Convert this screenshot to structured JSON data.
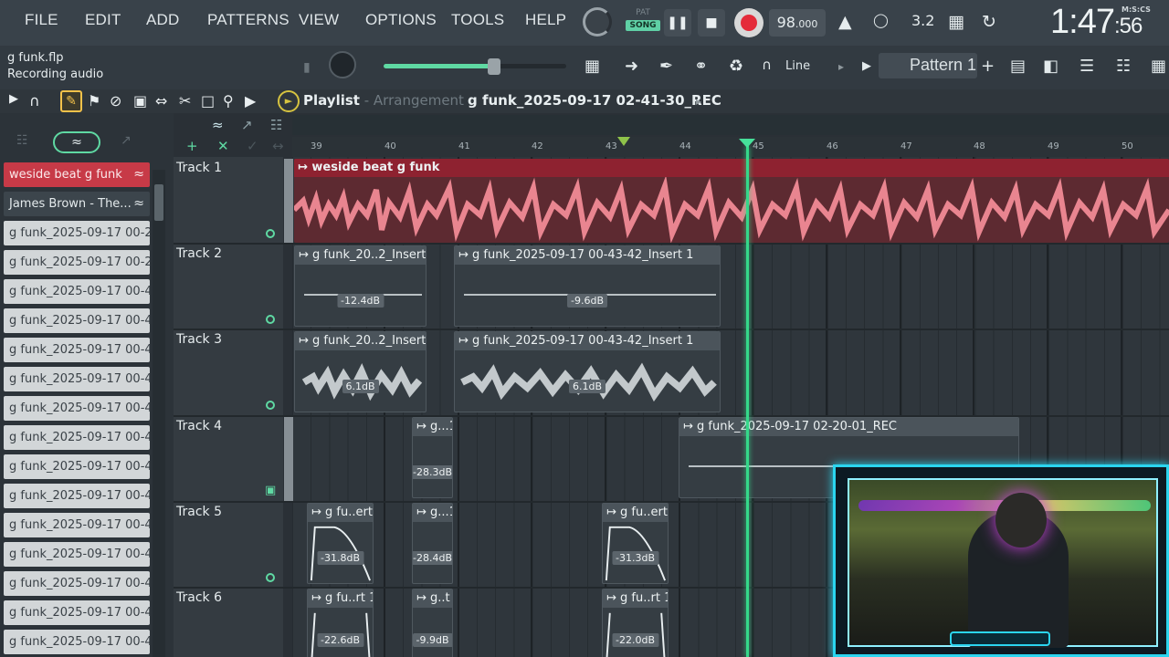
{
  "menu": [
    "FILE",
    "EDIT",
    "ADD",
    "PATTERNS",
    "VIEW",
    "OPTIONS",
    "TOOLS",
    "HELP"
  ],
  "transport": {
    "pat_label": "PAT",
    "song_label": "SONG",
    "tempo": "98",
    "tempo_decimal": ".000",
    "clock": "1:47",
    "clock_small": ":56",
    "clock_format": "M:S:CS",
    "cpu_readout": "3.2"
  },
  "project": {
    "filename": "g funk.flp",
    "status": "Recording audio"
  },
  "toolbar2": {
    "line_label": "Line",
    "pattern_label": "Pattern 1",
    "master_volume": 0.6
  },
  "playlist": {
    "title": "Playlist",
    "title_sep": " - ",
    "subtitle": "Arrangement",
    "recording_name": "g funk_2025-09-17 02-41-30_REC"
  },
  "browser_items": [
    "weside beat g funk",
    "James Brown - The...",
    "g funk_2025-09-17 00-2...",
    "g funk_2025-09-17 00-2...",
    "g funk_2025-09-17 00-4...",
    "g funk_2025-09-17 00-4...",
    "g funk_2025-09-17 00-4...",
    "g funk_2025-09-17 00-4...",
    "g funk_2025-09-17 00-4...",
    "g funk_2025-09-17 00-4...",
    "g funk_2025-09-17 00-4...",
    "g funk_2025-09-17 00-4...",
    "g funk_2025-09-17 00-4...",
    "g funk_2025-09-17 00-4...",
    "g funk_2025-09-17 00-4...",
    "g funk_2025-09-17 00-4...",
    "g funk_2025-09-17 00-4..."
  ],
  "ruler": {
    "bars": [
      "39",
      "40",
      "41",
      "42",
      "43",
      "44",
      "45",
      "46",
      "47",
      "48",
      "49",
      "50"
    ]
  },
  "tracks": [
    "Track 1",
    "Track 2",
    "Track 3",
    "Track 4",
    "Track 5",
    "Track 6"
  ],
  "clips": {
    "t1": {
      "name": "weside beat g funk"
    },
    "t2a": {
      "name": "g funk_20..2_Insert 1",
      "gain": "-12.4dB"
    },
    "t2b": {
      "name": "g funk_2025-09-17 00-43-42_Insert 1",
      "gain": "-9.6dB"
    },
    "t3a": {
      "name": "g funk_20..2_Insert 1",
      "gain": "6.1dB"
    },
    "t3b": {
      "name": "g funk_2025-09-17 00-43-42_Insert 1",
      "gain": "6.1dB"
    },
    "t4a": {
      "name": "g...1",
      "gain": "-28.3dB"
    },
    "t4b": {
      "name": "g funk_2025-09-17 02-20-01_REC"
    },
    "t5a": {
      "name": "g fu..ert 1",
      "gain": "-31.8dB"
    },
    "t5b": {
      "name": "g...1",
      "gain": "-28.4dB"
    },
    "t5c": {
      "name": "g fu..ert 1",
      "gain": "-31.3dB"
    },
    "t6a": {
      "name": "g fu..rt 1",
      "gain": "-22.6dB"
    },
    "t6b": {
      "name": "g..t 1",
      "gain": "-9.9dB"
    },
    "t6c": {
      "name": "g fu..rt 1",
      "gain": "-22.0dB"
    }
  },
  "colors": {
    "accent": "#5fd9a3",
    "playhead": "#35d88a",
    "record": "#e42b3a",
    "audio_clip": "#8e2230",
    "webcam_border": "#2bd5ef"
  }
}
